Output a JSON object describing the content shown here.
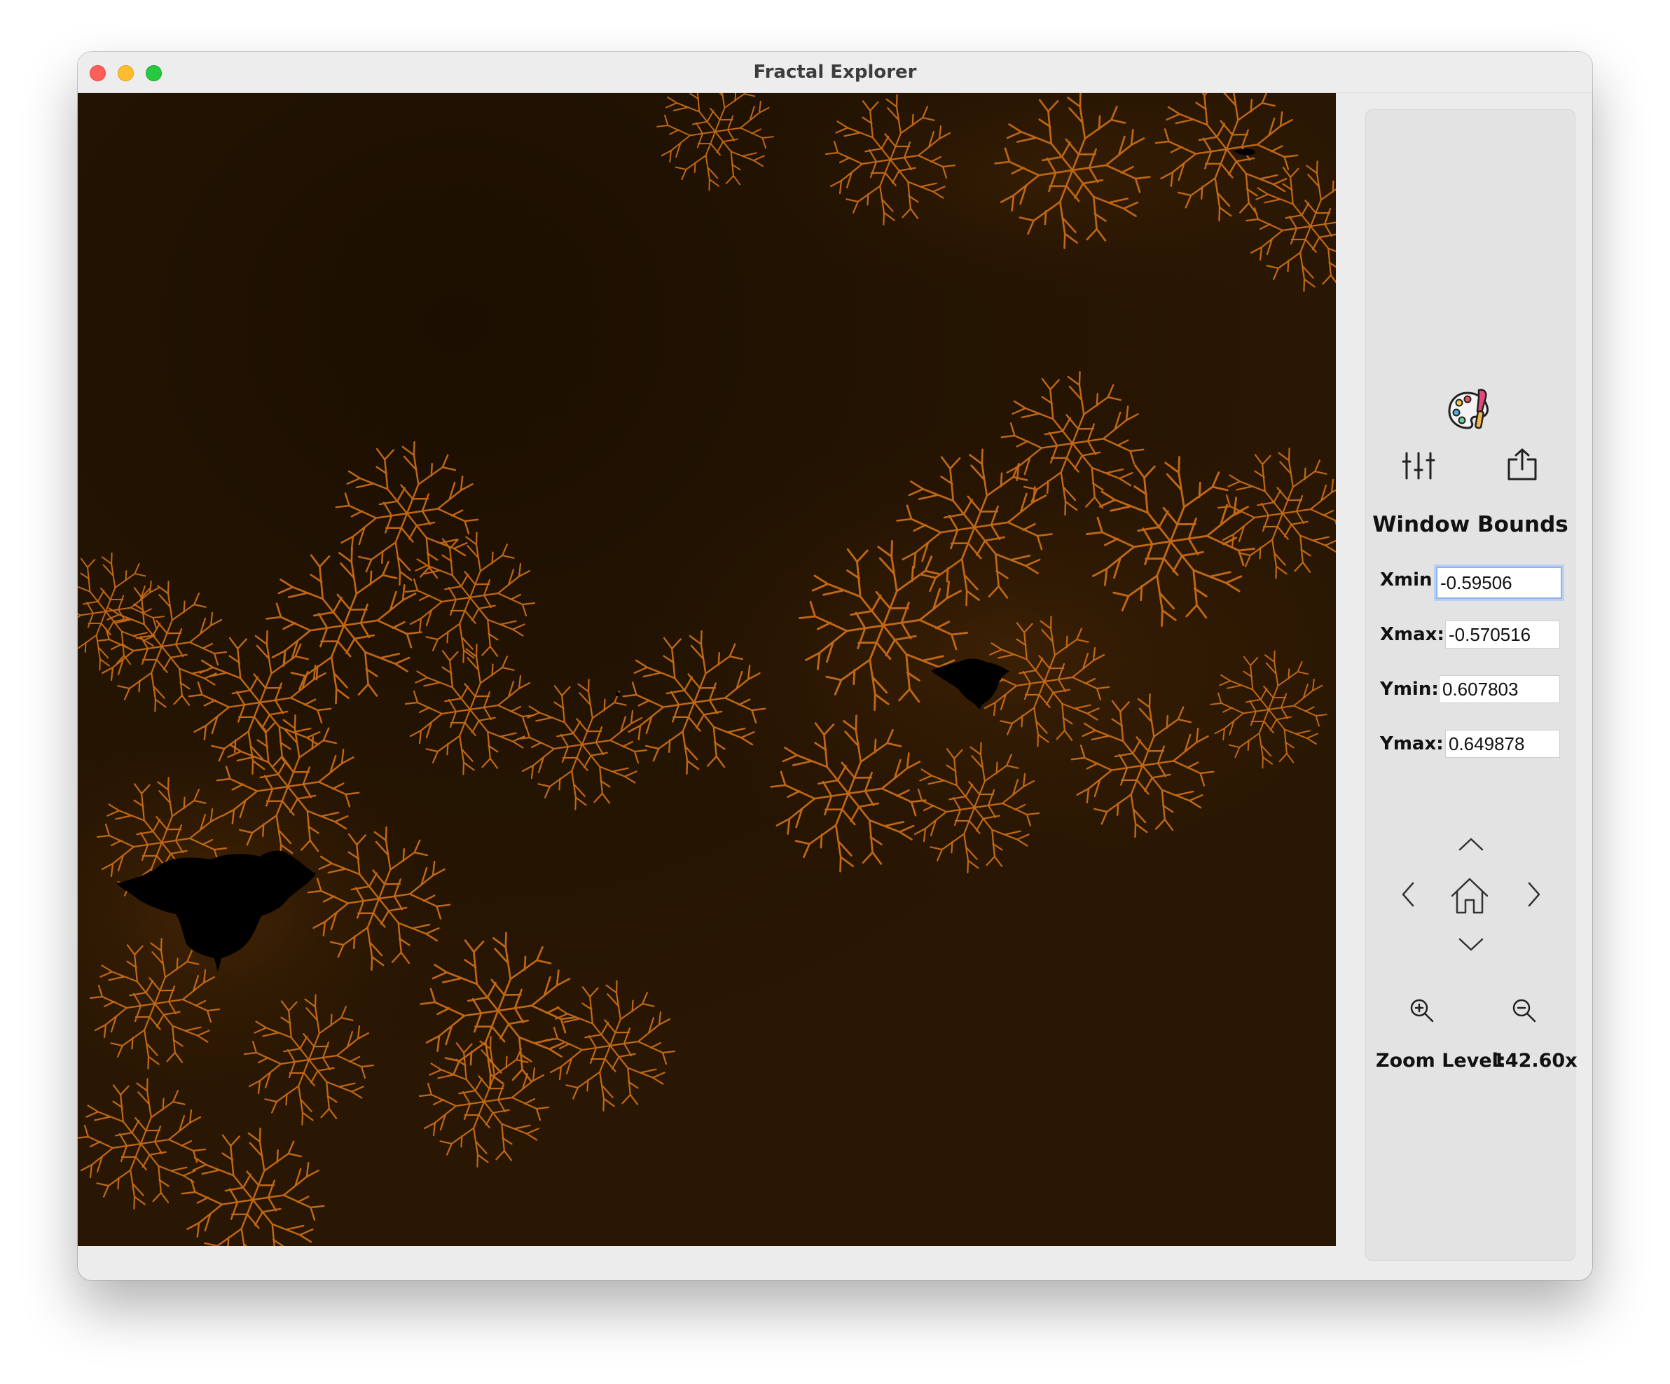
{
  "window": {
    "title": "Fractal Explorer"
  },
  "canvas": {
    "description_icon": "mandelbrot-render"
  },
  "sidebar": {
    "toolbar": {
      "palette_icon": "palette-icon",
      "settings_icon": "sliders-icon",
      "export_icon": "share-icon"
    },
    "bounds": {
      "title": "Window Bounds",
      "xmin_label": "Xmin:",
      "xmin_value": "-0.59506",
      "xmax_label": "Xmax:",
      "xmax_value": "-0.570516",
      "ymin_label": "Ymin:",
      "ymin_value": "0.607803",
      "ymax_label": "Ymax:",
      "ymax_value": "0.649878"
    },
    "navigation": {
      "up_icon": "chevron-up-icon",
      "down_icon": "chevron-down-icon",
      "left_icon": "chevron-left-icon",
      "right_icon": "chevron-right-icon",
      "home_icon": "home-icon",
      "zoom_in_icon": "zoom-in-icon",
      "zoom_out_icon": "zoom-out-icon"
    },
    "zoom": {
      "label": "Zoom Level:",
      "value": "142.60x"
    }
  },
  "colors": {
    "fractal_background": "#221302",
    "fractal_filament": "#d4761c",
    "fractal_set": "#000000",
    "focus_ring": "#8fb3ef"
  }
}
